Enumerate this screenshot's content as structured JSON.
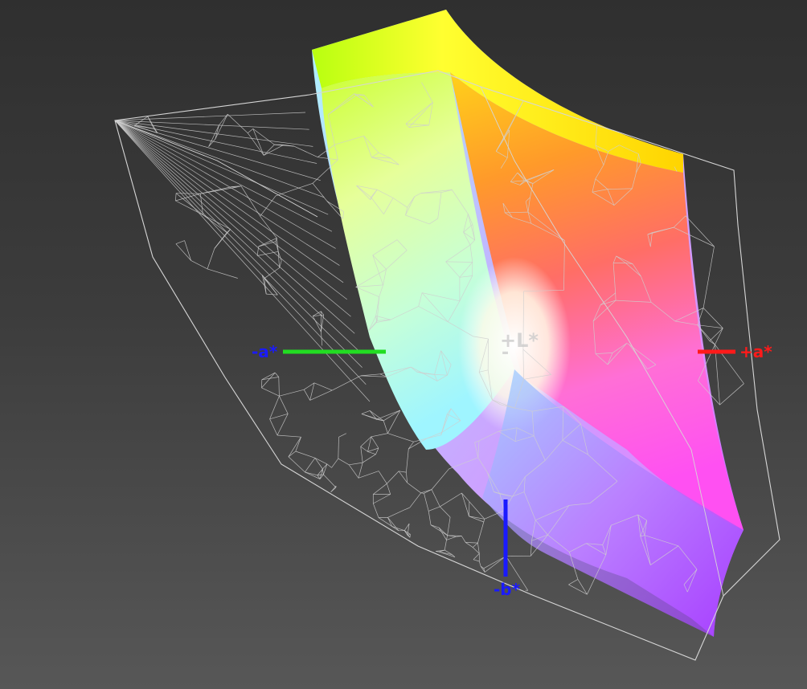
{
  "axes": {
    "plus_l": {
      "label": "+L*",
      "color": "#c8c8c8"
    },
    "minus_l": {
      "label": "-",
      "color": "#c8c8c8"
    },
    "plus_a": {
      "label": "+a*",
      "color": "#ff1a1a"
    },
    "minus_a": {
      "label": "-a*",
      "color": "#1a1aff",
      "line_color": "#22dd22"
    },
    "minus_b": {
      "label": "-b*",
      "color": "#1a1aff"
    }
  },
  "colors": {
    "wireframe": "#cfcfcf",
    "background_top": "#2f2f2f",
    "background_bottom": "#575757"
  }
}
